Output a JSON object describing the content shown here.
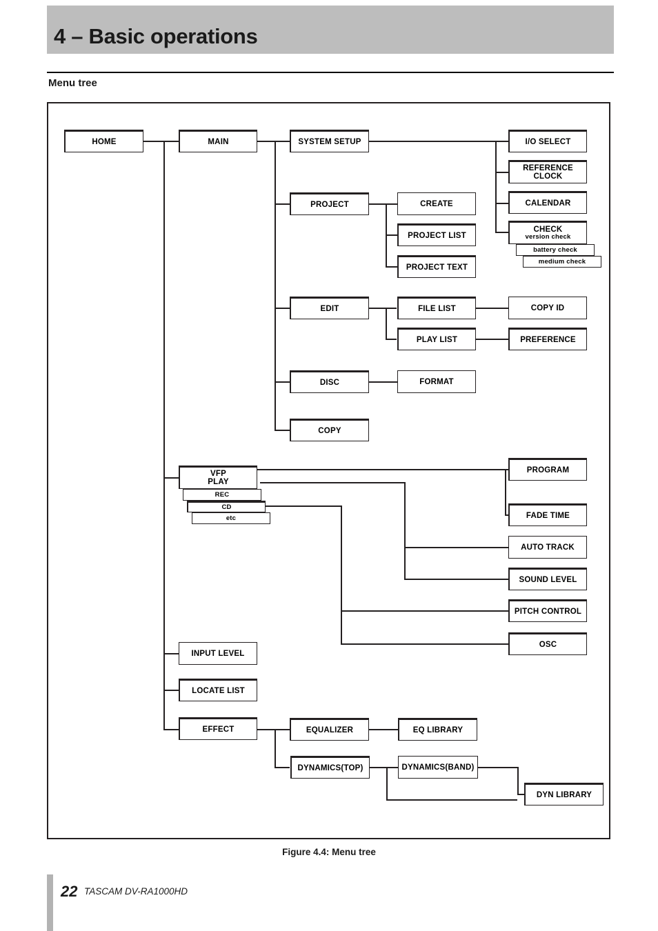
{
  "page": {
    "chapter_title": "4 – Basic operations",
    "section_title": "Menu tree",
    "figure_caption": "Figure 4.4: Menu tree",
    "footer_page_number": "22",
    "footer_model": "TASCAM  DV-RA1000HD",
    "header_band_color": "#bdbdbd",
    "line_color": "#231f20"
  },
  "nodes": {
    "home": "HOME",
    "main": "MAIN",
    "system_setup": "SYSTEM SETUP",
    "project": "PROJECT",
    "edit": "EDIT",
    "disc": "DISC",
    "copy": "COPY",
    "create": "CREATE",
    "project_list": "PROJECT LIST",
    "project_text": "PROJECT TEXT",
    "file_list": "FILE LIST",
    "play_list": "PLAY LIST",
    "format": "FORMAT",
    "io_select": "I/O SELECT",
    "reference_clock_l1": "REFERENCE",
    "reference_clock_l2": "CLOCK",
    "calendar": "CALENDAR",
    "check": "CHECK",
    "version_check": "version check",
    "battery_check": "battery check",
    "medium_check": "medium check",
    "copy_id": "COPY ID",
    "preference": "PREFERENCE",
    "vfp": "VFP",
    "vfp_play": "PLAY",
    "vfp_rec": "REC",
    "vfp_cd": "CD",
    "vfp_etc": "etc",
    "program": "PROGRAM",
    "fade_time": "FADE TIME",
    "auto_track": "AUTO TRACK",
    "sound_level": "SOUND LEVEL",
    "pitch_control": "PITCH CONTROL",
    "osc": "OSC",
    "input_level": "INPUT LEVEL",
    "locate_list": "LOCATE LIST",
    "effect": "EFFECT",
    "equalizer": "EQUALIZER",
    "eq_library": "EQ LIBRARY",
    "dynamics_top": "DYNAMICS(TOP)",
    "dynamics_band": "DYNAMICS(BAND)",
    "dyn_library": "DYN LIBRARY"
  }
}
